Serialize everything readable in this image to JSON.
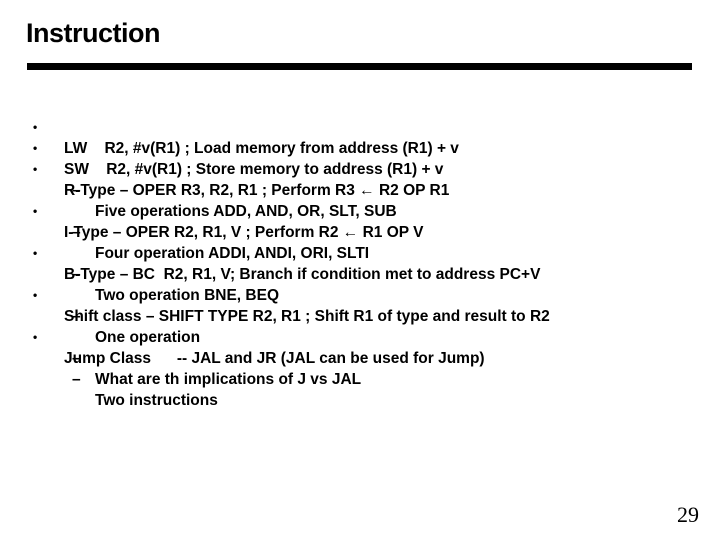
{
  "slide": {
    "title": "Instruction",
    "page_number": "29",
    "items": [
      {
        "level": 1,
        "marker": "•",
        "text": "LW    R2, #v(R1) ; Load memory from address (R1) + v"
      },
      {
        "level": 1,
        "marker": "•",
        "text": "SW    R2, #v(R1) ; Store memory to address (R1) + v"
      },
      {
        "level": 1,
        "marker": "•",
        "text": "R-Type – OPER R3, R2, R1 ; Perform R3 ← R2 OP R1"
      },
      {
        "level": 2,
        "marker": "–",
        "text": "Five operations ADD, AND, OR, SLT, SUB"
      },
      {
        "level": 1,
        "marker": "•",
        "text": "I-Type – OPER R2, R1, V ; Perform R2 ← R1 OP V"
      },
      {
        "level": 2,
        "marker": "–",
        "text": "Four operation ADDI, ANDI, ORI, SLTI"
      },
      {
        "level": 1,
        "marker": "•",
        "text": "B-Type – BC  R2, R1, V; Branch if condition met to address PC+V"
      },
      {
        "level": 2,
        "marker": "–",
        "text": "Two operation BNE, BEQ"
      },
      {
        "level": 1,
        "marker": "•",
        "text": "Shift class – SHIFT TYPE R2, R1 ; Shift R1 of type and result to R2"
      },
      {
        "level": 2,
        "marker": "–",
        "text": "One operation"
      },
      {
        "level": 1,
        "marker": "•",
        "text": "Jump Class      -- JAL and JR (JAL can be used for Jump)"
      },
      {
        "level": 2,
        "marker": "–",
        "text": "What are th implications of J vs JAL"
      },
      {
        "level": 2,
        "marker": "–",
        "text": "Two instructions"
      }
    ]
  }
}
